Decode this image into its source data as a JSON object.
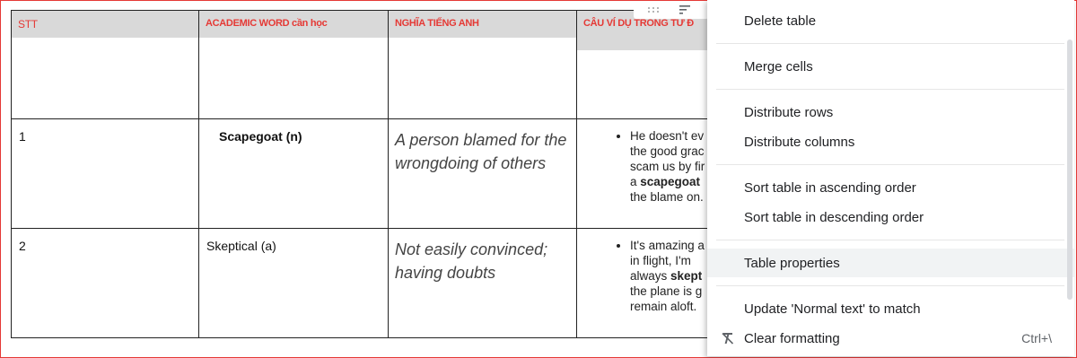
{
  "table": {
    "headers": [
      "STT",
      "ACADEMIC WORD cần học",
      "NGHĨA TIẾNG ANH",
      "CÂU VÍ DỤ TRONG TỪ Đ"
    ],
    "rows": [
      {
        "stt": "1",
        "word": "Scapegoat (n)",
        "meaning": "A person blamed for the wrongdoing of others",
        "example_lines": [
          "He doesn't ev",
          "the good grac",
          "scam us by fir"
        ],
        "example_pre": "a ",
        "example_bold": "scapegoat",
        "example_tail": "the blame on."
      },
      {
        "stt": "2",
        "word": "Skeptical (a)",
        "meaning": "Not easily convinced; having doubts",
        "example_lines": [
          "It's amazing a",
          "in flight, I'm"
        ],
        "example_pre": "always ",
        "example_bold": "skept",
        "example_tail_lines": [
          "the plane is g",
          "remain aloft."
        ]
      }
    ]
  },
  "toolbar": {
    "drag_icon": "drag-handle-icon",
    "sort_icon": "sort-icon"
  },
  "menu": {
    "items": [
      {
        "label": "Delete table"
      },
      {
        "label": "Merge cells"
      },
      {
        "label": "Distribute rows"
      },
      {
        "label": "Distribute columns"
      },
      {
        "label": "Sort table in ascending order"
      },
      {
        "label": "Sort table in descending order"
      },
      {
        "label": "Table properties"
      },
      {
        "label": "Update 'Normal text' to match"
      },
      {
        "label": "Clear formatting",
        "shortcut": "Ctrl+\\",
        "icon": "clear-formatting-icon"
      }
    ]
  },
  "colors": {
    "header_text": "#e53935",
    "header_bg": "#d9d9d9",
    "frame": "#e53935",
    "hover": "#f1f3f4"
  }
}
